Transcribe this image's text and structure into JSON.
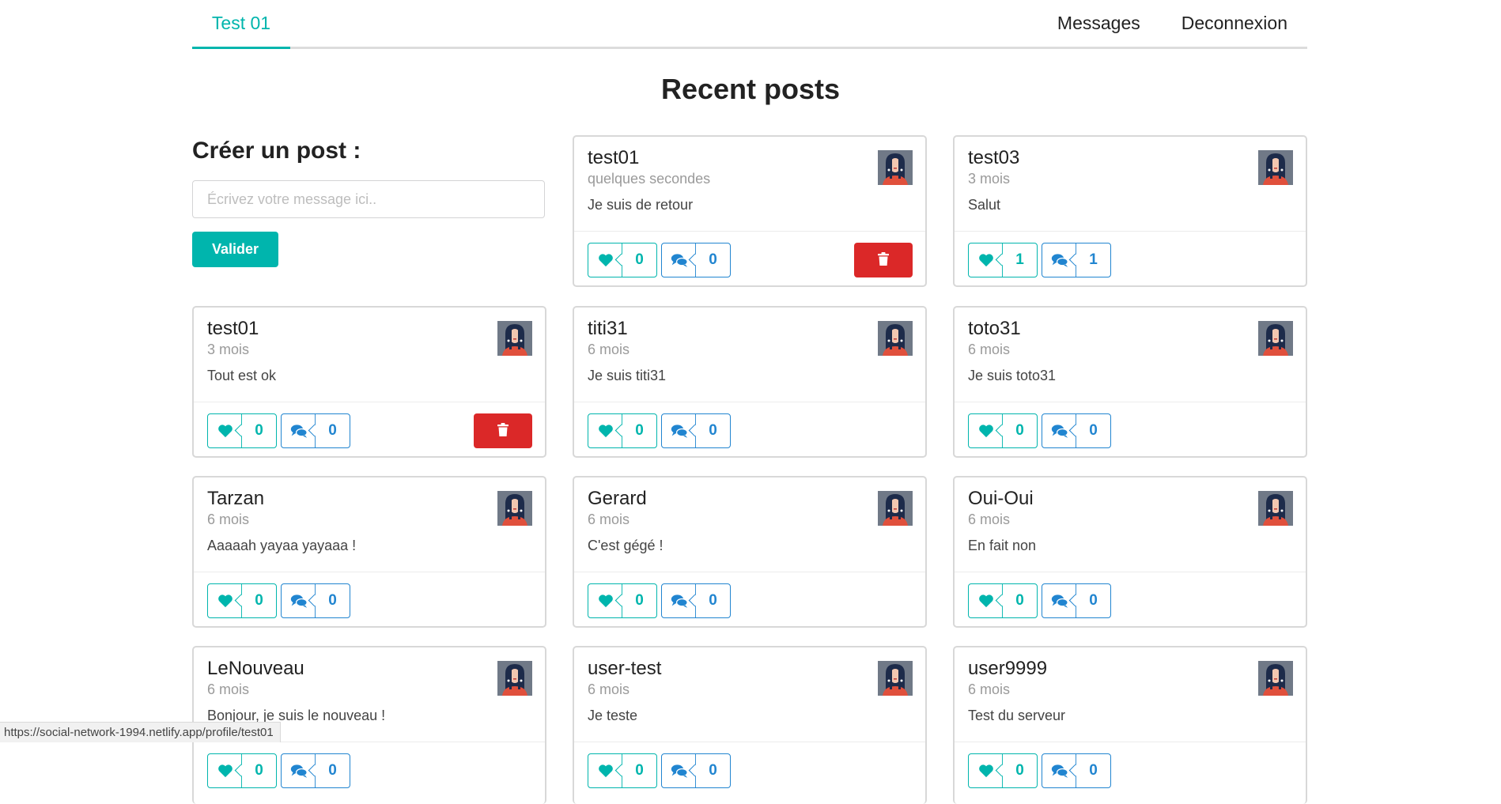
{
  "nav": {
    "active_tab": "Test 01",
    "links": [
      "Messages",
      "Deconnexion"
    ]
  },
  "page": {
    "title": "Recent posts"
  },
  "create_post": {
    "title": "Créer un post :",
    "placeholder": "Écrivez votre message ici..",
    "submit_label": "Valider"
  },
  "posts": [
    {
      "author": "test01",
      "time": "quelques secondes",
      "text": "Je suis de retour",
      "likes": "0",
      "comments": "0",
      "can_delete": true
    },
    {
      "author": "test03",
      "time": "3 mois",
      "text": "Salut",
      "likes": "1",
      "comments": "1",
      "can_delete": false
    },
    {
      "author": "test01",
      "time": "3 mois",
      "text": "Tout est ok",
      "likes": "0",
      "comments": "0",
      "can_delete": true
    },
    {
      "author": "titi31",
      "time": "6 mois",
      "text": "Je suis titi31",
      "likes": "0",
      "comments": "0",
      "can_delete": false
    },
    {
      "author": "toto31",
      "time": "6 mois",
      "text": "Je suis toto31",
      "likes": "0",
      "comments": "0",
      "can_delete": false
    },
    {
      "author": "Tarzan",
      "time": "6 mois",
      "text": "Aaaaah yayaa yayaaa !",
      "likes": "0",
      "comments": "0",
      "can_delete": false
    },
    {
      "author": "Gerard",
      "time": "6 mois",
      "text": "C'est gégé !",
      "likes": "0",
      "comments": "0",
      "can_delete": false
    },
    {
      "author": "Oui-Oui",
      "time": "6 mois",
      "text": "En fait non",
      "likes": "0",
      "comments": "0",
      "can_delete": false
    },
    {
      "author": "LeNouveau",
      "time": "6 mois",
      "text": "Bonjour, je suis le nouveau !",
      "likes": "0",
      "comments": "0",
      "can_delete": false
    },
    {
      "author": "user-test",
      "time": "6 mois",
      "text": "Je teste",
      "likes": "0",
      "comments": "0",
      "can_delete": false
    },
    {
      "author": "user9999",
      "time": "6 mois",
      "text": "Test du serveur",
      "likes": "0",
      "comments": "0",
      "can_delete": false
    }
  ],
  "icons": {
    "like": "heart-icon",
    "comment": "comments-icon",
    "delete": "trash-icon"
  },
  "colors": {
    "accent": "#00b5ad",
    "comment": "#2185d0",
    "danger": "#db2828"
  },
  "status_bar": {
    "url": "https://social-network-1994.netlify.app/profile/test01"
  }
}
